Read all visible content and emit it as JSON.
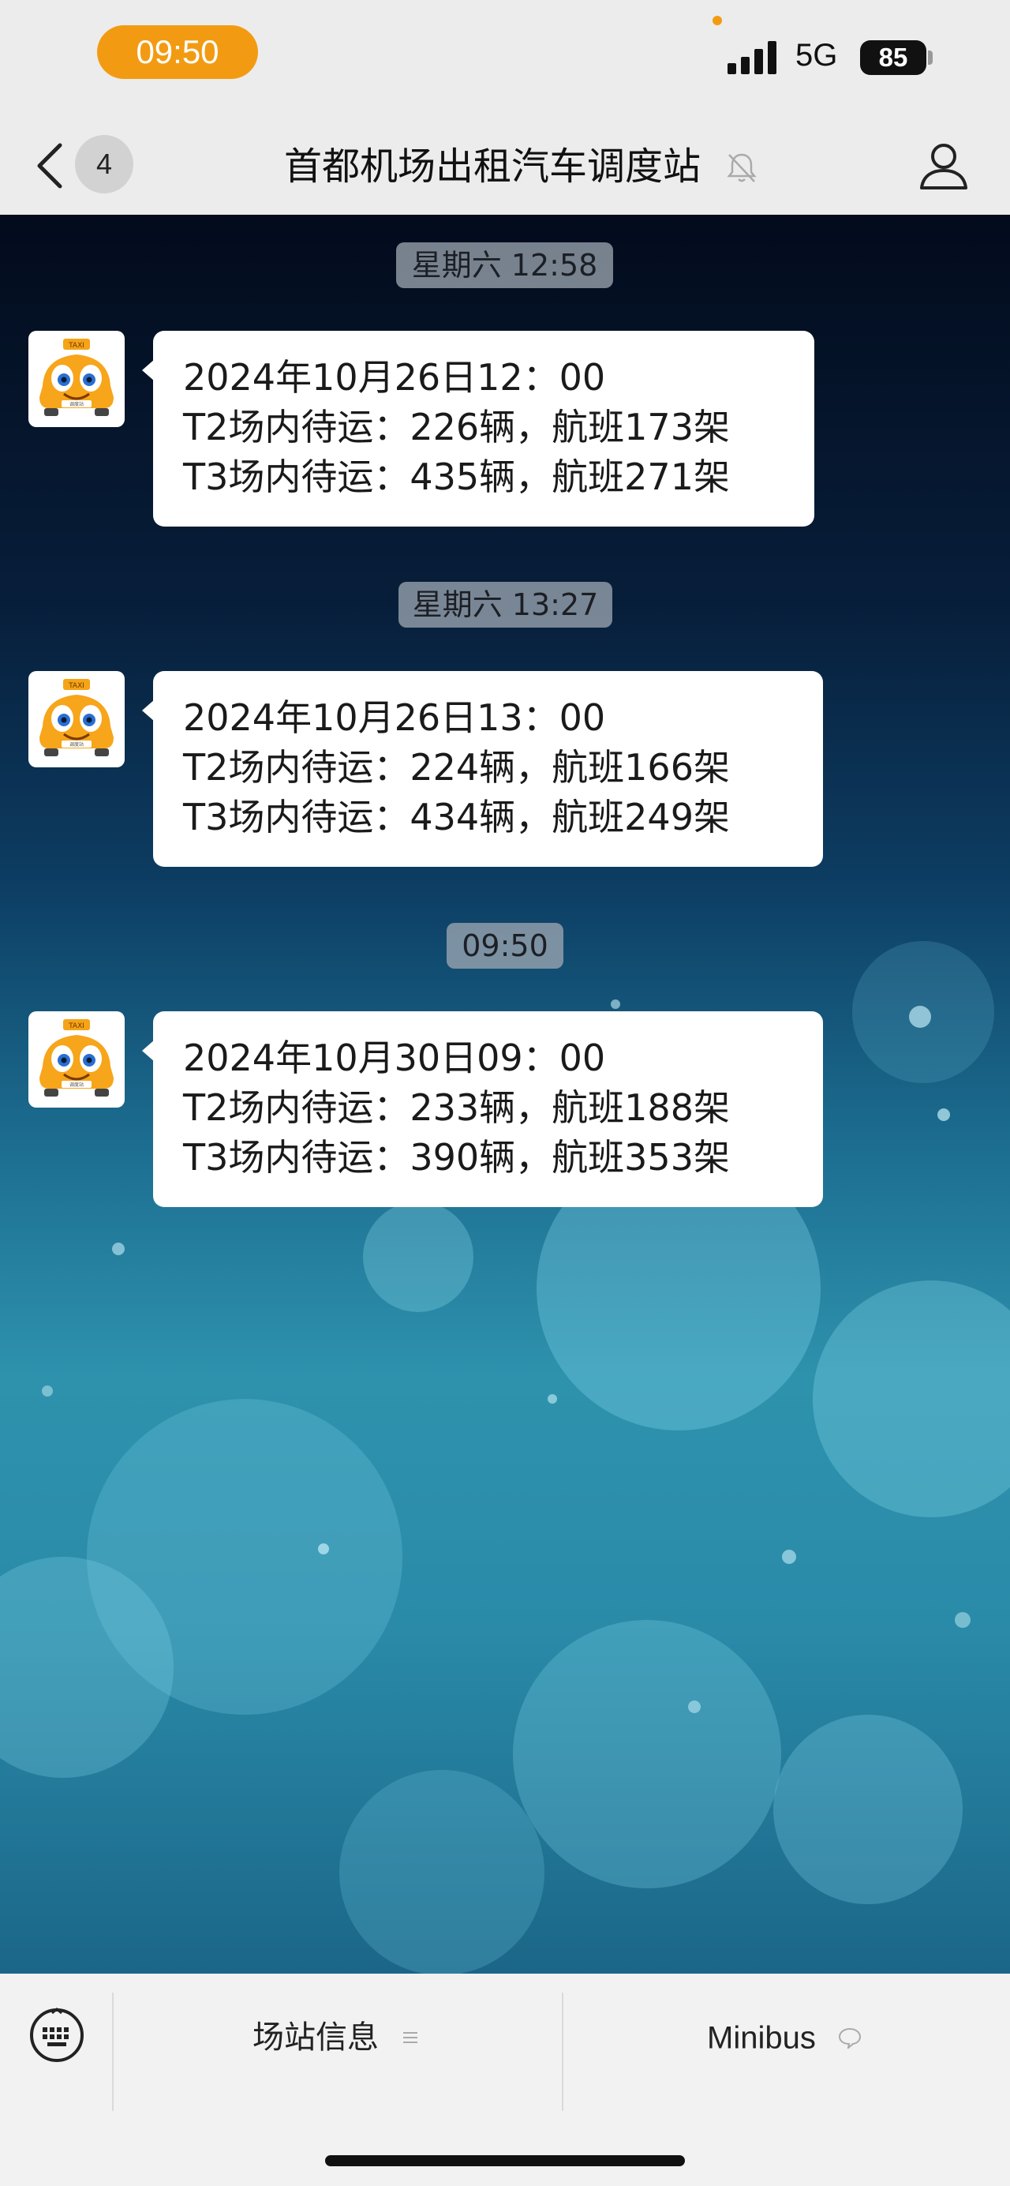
{
  "status_bar": {
    "time": "09:50",
    "network": "5G",
    "battery": "85"
  },
  "nav": {
    "back_count": "4",
    "title": "首都机场出租汽车调度站"
  },
  "messages": [
    {
      "timestamp": "星期六 12:58",
      "lines": [
        "2024年10月26日12：00",
        "T2场内待运：226辆，航班173架",
        "T3场内待运：435辆，航班271架"
      ]
    },
    {
      "timestamp": "星期六 13:27",
      "lines": [
        "2024年10月26日13：00",
        "T2场内待运：224辆，航班166架",
        "T3场内待运：434辆，航班249架"
      ]
    },
    {
      "timestamp": "09:50",
      "lines": [
        "2024年10月30日09：00",
        "T2场内待运：233辆，航班188架",
        "T3场内待运：390辆，航班353架"
      ]
    }
  ],
  "bottom_menu": {
    "items": [
      {
        "label": "场站信息",
        "icon": "menu-list-icon"
      },
      {
        "label": "Minibus",
        "icon": "chat-bubble-icon"
      }
    ]
  },
  "avatar": {
    "sign_text": "TAXI",
    "plate_text": "调度站"
  },
  "colors": {
    "accent": "#f29b12",
    "bubble": "#ffffff",
    "header": "#ececec"
  }
}
